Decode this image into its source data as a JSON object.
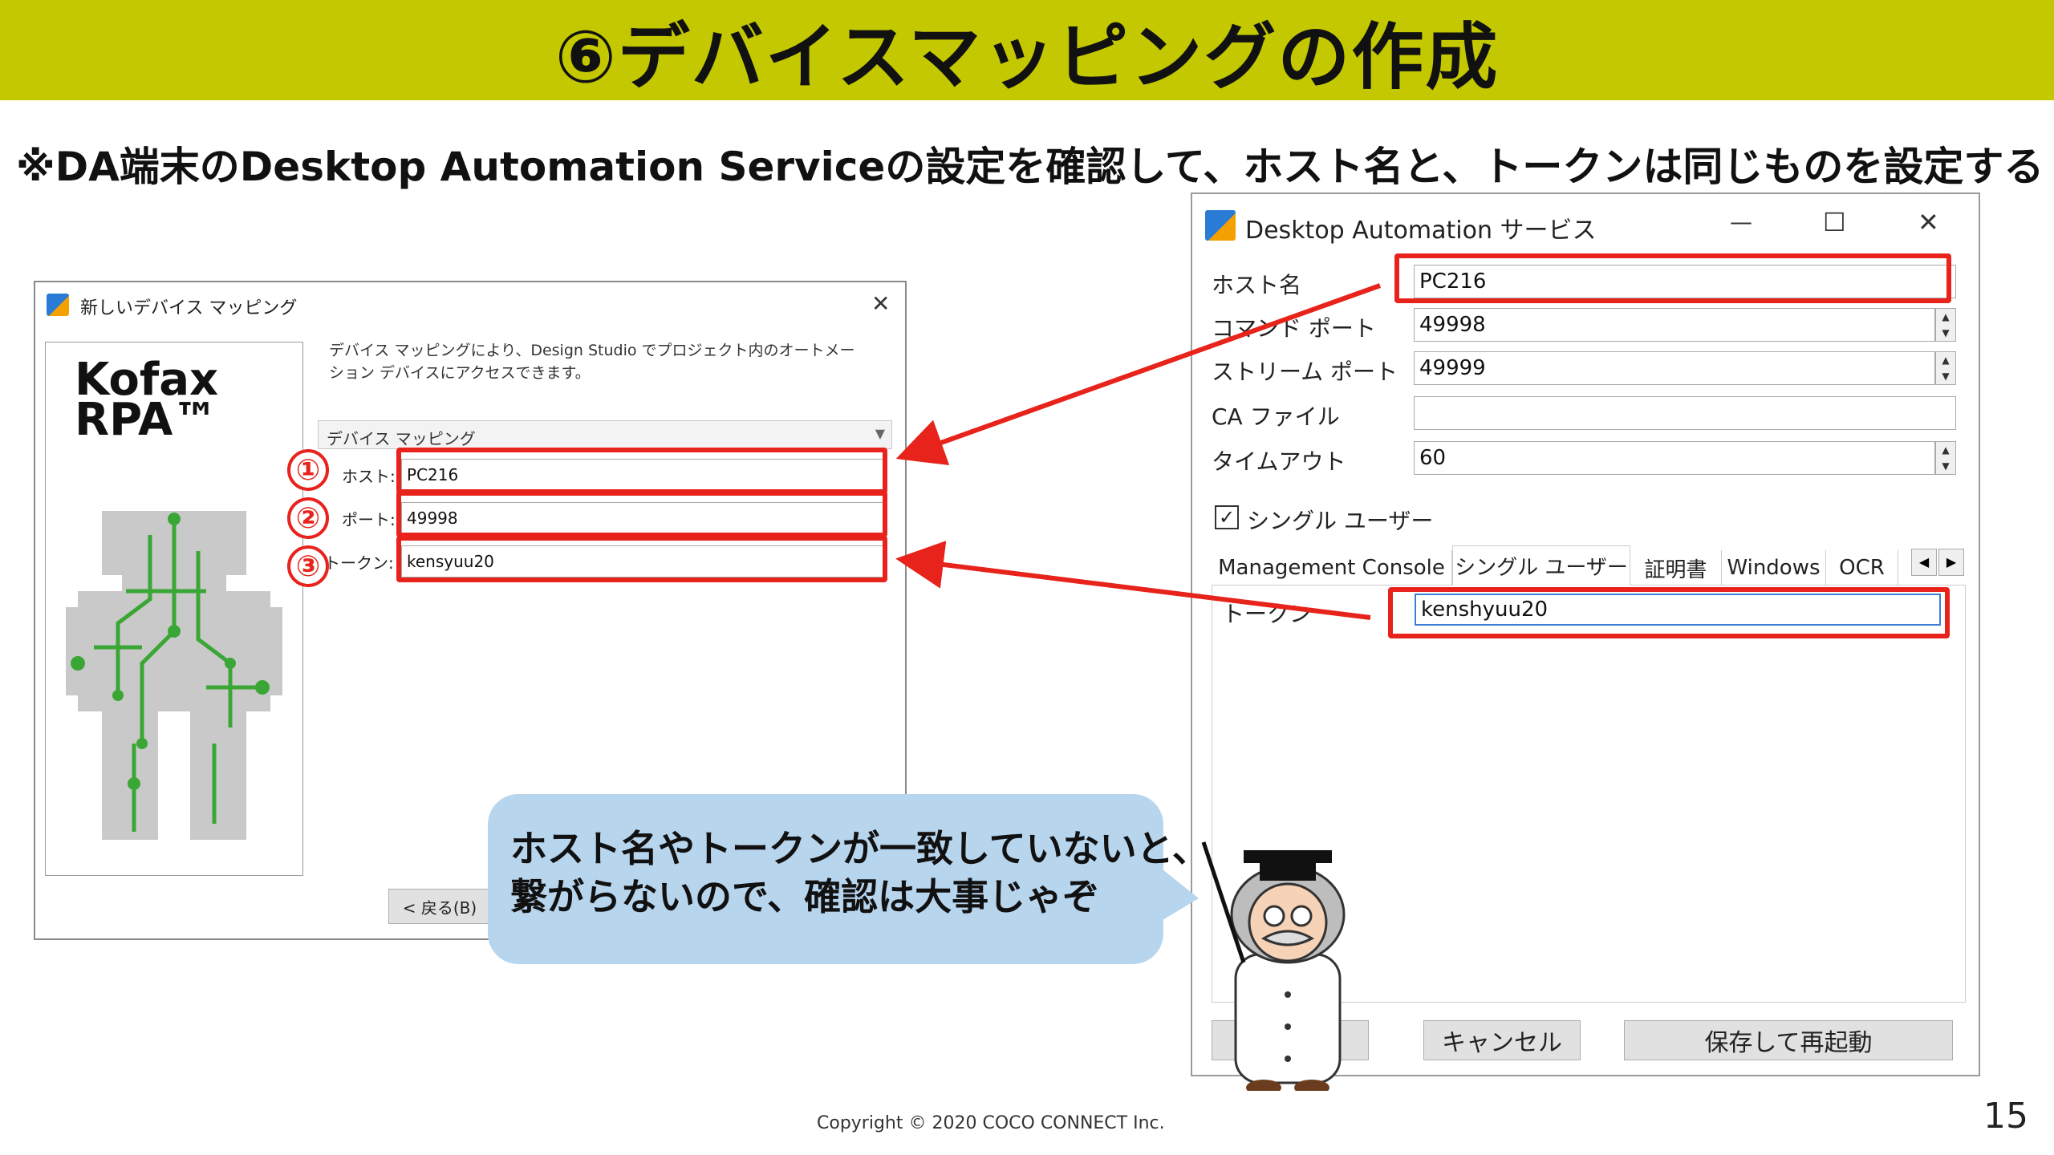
{
  "header": {
    "title": "⑥デバイスマッピングの作成"
  },
  "subtitle": "※DA端末のDesktop Automation Serviceの設定を確認して、ホスト名と、トークンは同じものを設定する",
  "left_dialog": {
    "title": "新しいデバイス マッピング",
    "close": "✕",
    "logo_line1": "Kofax",
    "logo_line2": "RPA™",
    "description_line1": "デバイス マッピングにより、Design Studio でプロジェクト内のオートメー",
    "description_line2": "ション デバイスにアクセスできます。",
    "dropdown": "デバイス マッピング",
    "host_label": "ホスト:",
    "host_value": "PC216",
    "port_label": "ポート:",
    "port_value": "49998",
    "token_label": "トークン:",
    "token_value": "kensyuu20",
    "back_button": "< 戻る(B)"
  },
  "numbers": {
    "n1": "①",
    "n2": "②",
    "n3": "③"
  },
  "right_dialog": {
    "title": "Desktop Automation サービス",
    "minimize": "—",
    "maximize": "☐",
    "close": "✕",
    "host_label": "ホスト名",
    "host_value": "PC216",
    "command_port_label": "コマンド ポート",
    "command_port_value": "49998",
    "stream_port_label": "ストリーム ポート",
    "stream_port_value": "49999",
    "ca_file_label": "CA ファイル",
    "ca_file_value": "",
    "timeout_label": "タイムアウト",
    "timeout_value": "60",
    "single_user_checkbox": "シングル ユーザー",
    "tabs": [
      "Management Console",
      "シングル ユーザー",
      "証明書",
      "Windows",
      "OCR"
    ],
    "token_label": "トークン",
    "token_value": "kenshyuu20",
    "cancel_button": "キャンセル",
    "save_button": "保存して再起動"
  },
  "bubble": {
    "line1": "ホスト名やトークンが一致していないと、",
    "line2": "繋がらないので、確認は大事じゃぞ"
  },
  "footer": {
    "copyright": "Copyright © 2020 COCO CONNECT Inc.",
    "page": "15"
  },
  "colors": {
    "header": "#c3c800",
    "accent_red": "#e7231b",
    "bubble": "#b8d5ee"
  }
}
